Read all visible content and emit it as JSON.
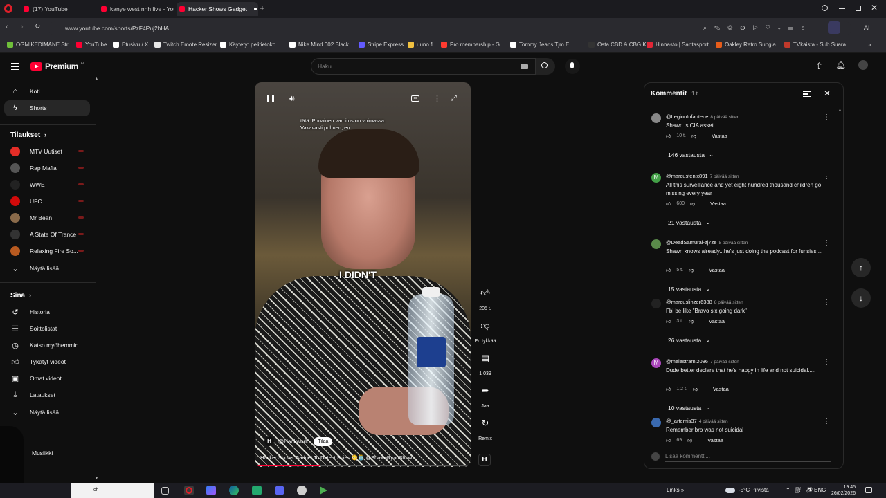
{
  "browser": {
    "tabs": [
      {
        "label": "(17) YouTube"
      },
      {
        "label": "kanye west nhh live - You"
      },
      {
        "label": "Hacker Shows Gadget"
      }
    ],
    "url": "www.youtube.com/shorts/PzF4Puj2bHA",
    "profile_label": "AI",
    "bookmarks": [
      {
        "label": "OGMIKEDIMANE Str...",
        "color": "#6fbf3a"
      },
      {
        "label": "YouTube",
        "color": "#ff0033"
      },
      {
        "label": "Etusivu / X",
        "color": "#ffffff"
      },
      {
        "label": "Twitch Emote Resizer",
        "color": "#e8e8e8"
      },
      {
        "label": "Käytetyt pelitietoko...",
        "color": "#ffffff"
      },
      {
        "label": "Nike Mind 002 Black...",
        "color": "#ffffff"
      },
      {
        "label": "Stripe Express",
        "color": "#635bff"
      },
      {
        "label": "uuno.fi",
        "color": "#f0c040"
      },
      {
        "label": "Pro membership - G...",
        "color": "#ff3b30"
      },
      {
        "label": "Tommy Jeans Tjm E...",
        "color": "#ffffff"
      },
      {
        "label": "Osta CBD & CBG Ke...",
        "color": "#333333"
      },
      {
        "label": "Hinnasto | Santasport",
        "color": "#e32636"
      },
      {
        "label": "Oakley Retro Sungla...",
        "color": "#e65c1a"
      },
      {
        "label": "TVkaista - Sub Suara",
        "color": "#c0392b"
      }
    ]
  },
  "youtube": {
    "logo": "Premium",
    "logo_sup": "FI",
    "search_placeholder": "Haku",
    "sidebar": {
      "top": [
        {
          "label": "Koti",
          "icon": "home-icon"
        },
        {
          "label": "Shorts",
          "icon": "shorts-icon"
        }
      ],
      "subs_title": "Tilaukset",
      "subs": [
        {
          "label": "MTV Uutiset",
          "color": "#e52d27"
        },
        {
          "label": "Rap Mafia",
          "color": "#555555"
        },
        {
          "label": "WWE",
          "color": "#222222"
        },
        {
          "label": "UFC",
          "color": "#d20a0a"
        },
        {
          "label": "Mr Bean",
          "color": "#8a6a4a"
        },
        {
          "label": "A State Of Trance",
          "color": "#333333"
        },
        {
          "label": "Relaxing Fire So...",
          "color": "#b85a20"
        }
      ],
      "subs_more": "Näytä lisää",
      "you_title": "Sinä",
      "you": [
        {
          "label": "Historia",
          "icon": "history-icon"
        },
        {
          "label": "Soittolistat",
          "icon": "playlist-icon"
        },
        {
          "label": "Katso myöhemmin",
          "icon": "clock-icon"
        },
        {
          "label": "Tykätyt videot",
          "icon": "like-icon"
        },
        {
          "label": "Omat videot",
          "icon": "video-icon"
        },
        {
          "label": "Lataukset",
          "icon": "download-icon"
        }
      ],
      "you_more": "Näytä lisää",
      "music_label": "Musiikki"
    },
    "video": {
      "caption_top": "tätä. Punainen varoitus on voimassa. Vakavasti puhuen, en",
      "caption_main": "I DIDN'T",
      "channel": "@Hackworld",
      "subscribe": "Tilaa",
      "title": "Hacker Shows Gadget To Detect Spies 😳🫙 @ShawnRyanShow",
      "actions": [
        {
          "label": "205 t.",
          "icon": "thumb-up-icon"
        },
        {
          "label": "En tykkää",
          "icon": "thumb-down-icon"
        },
        {
          "label": "1 039",
          "icon": "comment-icon"
        },
        {
          "label": "Jaa",
          "icon": "share-icon"
        },
        {
          "label": "Remix",
          "icon": "remix-icon"
        }
      ]
    },
    "comments": {
      "title": "Kommentit",
      "count": "1 t.",
      "input_placeholder": "Lisää kommentti...",
      "reply_label": "Vastaa",
      "items": [
        {
          "author": "@LegionInfanterie",
          "time": "8 päivää sitten",
          "text": "Shawn is CIA asset....",
          "likes": "10 t.",
          "replies": "146 vastausta",
          "color": "#888888",
          "initial": ""
        },
        {
          "author": "@marcusfenix891",
          "time": "7 päivää sitten",
          "text": "All this surveillance and yet eight hundred thousand children go missing every year",
          "likes": "600",
          "replies": "21 vastausta",
          "color": "#43a047",
          "initial": "M"
        },
        {
          "author": "@DeadSamurai-zj7ze",
          "time": "8 päivää sitten",
          "text": "Shawn knows already...he's just doing the podcast for funsies....",
          "likes": "5 t.",
          "replies": "15 vastausta",
          "color": "#5a8a4a",
          "initial": ""
        },
        {
          "author": "@marcuslinzer6388",
          "time": "8 päivää sitten",
          "text": "Fbi be like \"Bravo six going dark\"",
          "likes": "3 t.",
          "replies": "26 vastausta",
          "color": "#222222",
          "initial": ""
        },
        {
          "author": "@melestrami2086",
          "time": "7 päivää sitten",
          "text": "Dude better declare that he's happy in life and not suicidal.....",
          "likes": "1,2 t.",
          "replies": "10 vastausta",
          "color": "#ab47bc",
          "initial": "M"
        },
        {
          "author": "@_artemis37",
          "time": "4 päivää sitten",
          "text": "Remember bro was not suicidal",
          "likes": "69",
          "replies": "",
          "color": "#3a6ab0",
          "initial": ""
        }
      ]
    }
  },
  "taskbar": {
    "search_text": "ch",
    "links": "Links",
    "weather": "-5°C Pilvistä",
    "lang": "ENG",
    "time": "19.45",
    "date": "26/02/2026"
  }
}
